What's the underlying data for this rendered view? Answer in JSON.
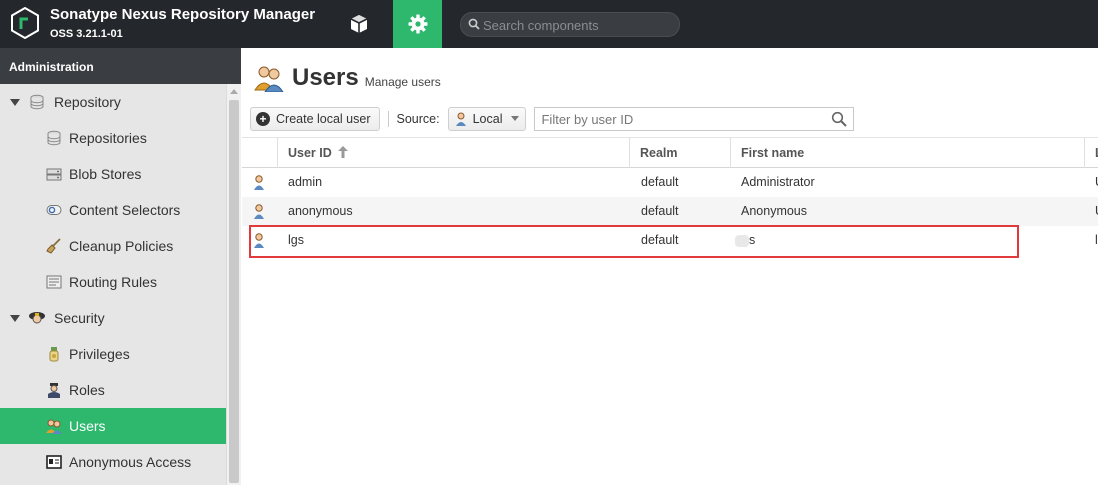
{
  "header": {
    "title": "Sonatype Nexus Repository Manager",
    "version": "OSS 3.21.1-01",
    "search_placeholder": "Search components"
  },
  "sidebar": {
    "title": "Administration",
    "groups": [
      {
        "label": "Repository",
        "icon": "database-icon",
        "items": [
          {
            "label": "Repositories",
            "icon": "database-icon"
          },
          {
            "label": "Blob Stores",
            "icon": "server-icon"
          },
          {
            "label": "Content Selectors",
            "icon": "selector-icon"
          },
          {
            "label": "Cleanup Policies",
            "icon": "broom-icon"
          },
          {
            "label": "Routing Rules",
            "icon": "routing-icon"
          }
        ]
      },
      {
        "label": "Security",
        "icon": "security-badge-icon",
        "items": [
          {
            "label": "Privileges",
            "icon": "medal-icon"
          },
          {
            "label": "Roles",
            "icon": "officer-icon"
          },
          {
            "label": "Users",
            "icon": "users-icon",
            "active": true
          },
          {
            "label": "Anonymous Access",
            "icon": "id-card-icon"
          }
        ]
      }
    ]
  },
  "main": {
    "title": "Users",
    "subtitle": "Manage users",
    "toolbar": {
      "create_label": "Create local user",
      "source_label": "Source:",
      "source_value": "Local",
      "filter_placeholder": "Filter by user ID"
    },
    "columns": [
      "User ID",
      "Realm",
      "First name",
      "L"
    ],
    "rows": [
      {
        "user_id": "admin",
        "realm": "default",
        "first_name": "Administrator",
        "last": "U"
      },
      {
        "user_id": "anonymous",
        "realm": "default",
        "first_name": "Anonymous",
        "last": "U"
      },
      {
        "user_id": "lgs",
        "realm": "default",
        "first_name": "s",
        "last": "l"
      }
    ]
  },
  "colors": {
    "header_bg": "#24272b",
    "accent": "#2db86e",
    "highlight_border": "#e23a3a"
  }
}
